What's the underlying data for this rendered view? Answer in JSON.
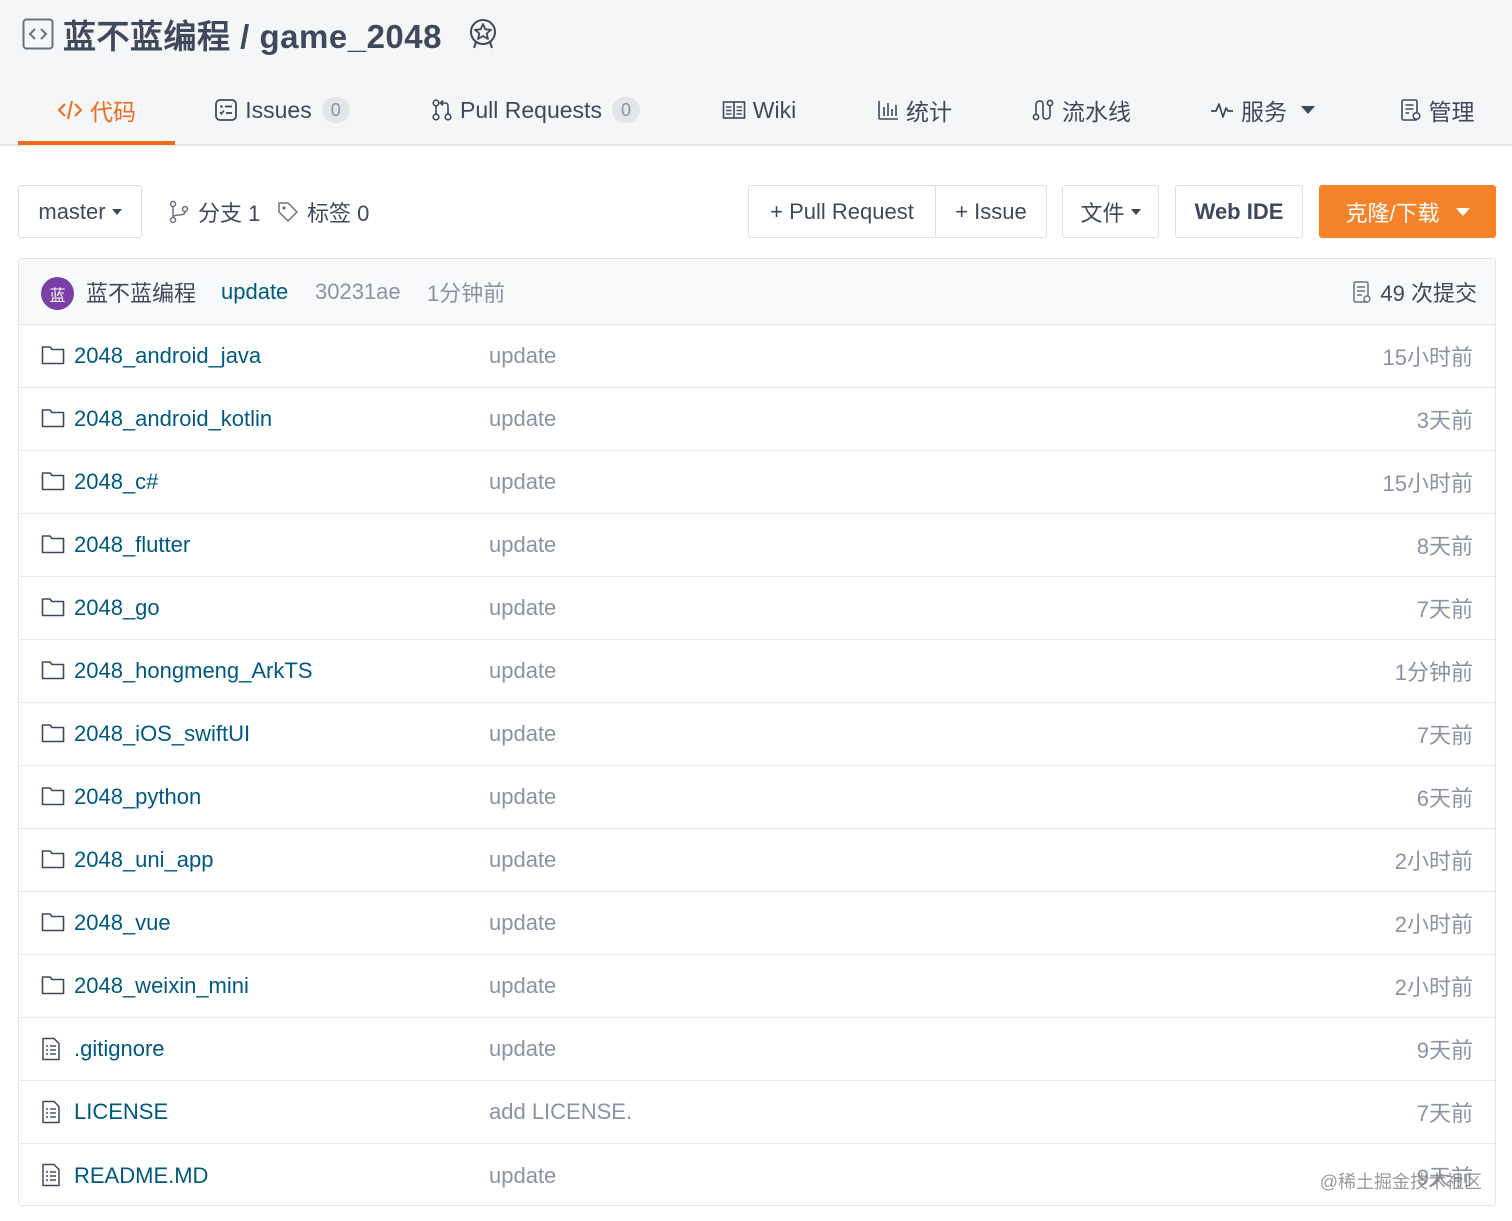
{
  "repo": {
    "owner": "蓝不蓝编程",
    "separator": " / ",
    "name": "game_2048"
  },
  "tabs": [
    {
      "label": "代码",
      "icon": "code-icon",
      "active": true
    },
    {
      "label": "Issues",
      "icon": "issues-icon",
      "count": "0"
    },
    {
      "label": "Pull Requests",
      "icon": "pull-request-icon",
      "count": "0"
    },
    {
      "label": "Wiki",
      "icon": "wiki-icon"
    },
    {
      "label": "统计",
      "icon": "stats-icon"
    },
    {
      "label": "流水线",
      "icon": "pipeline-icon"
    },
    {
      "label": "服务",
      "icon": "service-icon",
      "dropdown": true
    },
    {
      "label": "管理",
      "icon": "manage-icon"
    }
  ],
  "toolbar": {
    "branch": "master",
    "branches": "分支 1",
    "tags": "标签 0",
    "new_pr": "+ Pull Request",
    "new_issue": "+ Issue",
    "file_menu": "文件",
    "web_ide": "Web IDE",
    "clone": "克隆/下载"
  },
  "commit": {
    "avatar_text": "蓝",
    "author": "蓝不蓝编程",
    "message": "update",
    "hash": "30231ae",
    "time": "1分钟前",
    "count": "49 次提交",
    "avatar_color": "#7b3fa8"
  },
  "files": [
    {
      "type": "folder",
      "name": "2048_android_java",
      "message": "update",
      "time": "15小时前"
    },
    {
      "type": "folder",
      "name": "2048_android_kotlin",
      "message": "update",
      "time": "3天前"
    },
    {
      "type": "folder",
      "name": "2048_c#",
      "message": "update",
      "time": "15小时前"
    },
    {
      "type": "folder",
      "name": "2048_flutter",
      "message": "update",
      "time": "8天前"
    },
    {
      "type": "folder",
      "name": "2048_go",
      "message": "update",
      "time": "7天前"
    },
    {
      "type": "folder",
      "name": "2048_hongmeng_ArkTS",
      "message": "update",
      "time": "1分钟前"
    },
    {
      "type": "folder",
      "name": "2048_iOS_swiftUI",
      "message": "update",
      "time": "7天前"
    },
    {
      "type": "folder",
      "name": "2048_python",
      "message": "update",
      "time": "6天前"
    },
    {
      "type": "folder",
      "name": "2048_uni_app",
      "message": "update",
      "time": "2小时前"
    },
    {
      "type": "folder",
      "name": "2048_vue",
      "message": "update",
      "time": "2小时前"
    },
    {
      "type": "folder",
      "name": "2048_weixin_mini",
      "message": "update",
      "time": "2小时前"
    },
    {
      "type": "file",
      "name": ".gitignore",
      "message": "update",
      "time": "9天前"
    },
    {
      "type": "file",
      "name": "LICENSE",
      "message": "add LICENSE.",
      "time": "7天前"
    },
    {
      "type": "file",
      "name": "README.MD",
      "message": "update",
      "time": "9天前"
    }
  ],
  "watermark": "@稀土掘金技术社区",
  "colors": {
    "accent": "#f26b1c",
    "clone_button": "#f6822a",
    "link": "#005980",
    "muted": "#8c92a4"
  }
}
